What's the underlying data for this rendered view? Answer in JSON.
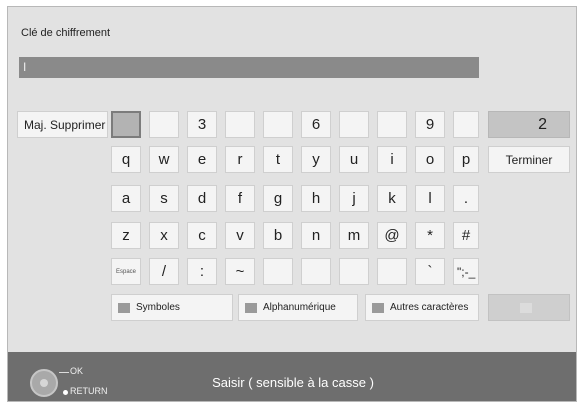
{
  "header": {
    "title": "Clé de chiffrement"
  },
  "input": {
    "value": "I"
  },
  "keys": {
    "shift_delete": "Maj. Supprimer",
    "r0": [
      "",
      "",
      "3",
      "",
      "",
      "6",
      "",
      "",
      "9",
      ""
    ],
    "display_count": "2",
    "finish": "Terminer",
    "r1": [
      "q",
      "w",
      "e",
      "r",
      "t",
      "y",
      "u",
      "i",
      "o",
      "p"
    ],
    "r2": [
      "a",
      "s",
      "d",
      "f",
      "g",
      "h",
      "j",
      "k",
      "l",
      "."
    ],
    "r3": [
      "z",
      "x",
      "c",
      "v",
      "b",
      "n",
      "m",
      "@",
      "*",
      "#"
    ],
    "r4": [
      "Espace",
      "/",
      ":",
      "~",
      "",
      "",
      "",
      "",
      "`",
      "\";-_"
    ],
    "mode_symbols": "Symboles",
    "mode_alnum": "Alphanumérique",
    "mode_other": "Autres caractères"
  },
  "footer": {
    "ok_label": "OK",
    "return_label": "RETURN",
    "hint": "Saisir ( sensible à la casse )"
  }
}
